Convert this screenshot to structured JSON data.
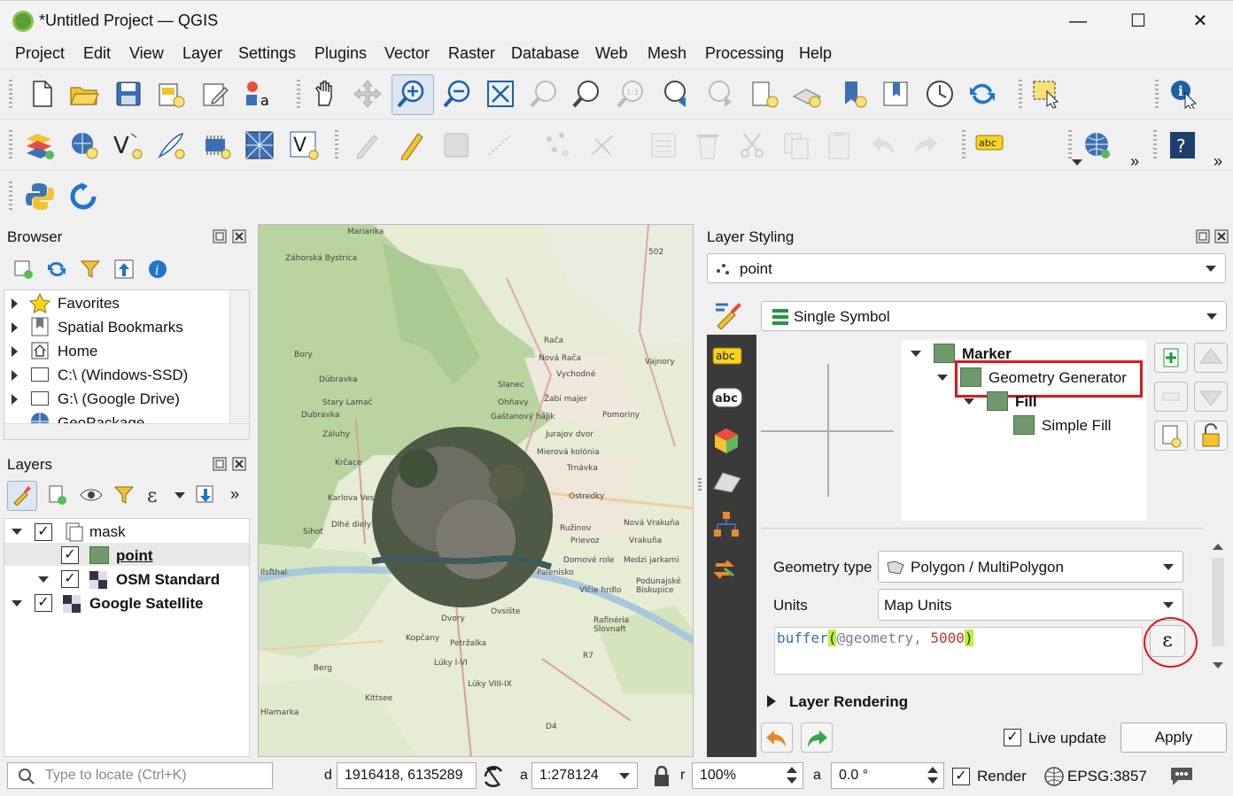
{
  "window": {
    "title": "*Untitled Project — QGIS",
    "minimize": "—",
    "maximize": "☐",
    "close": "✕"
  },
  "menu": [
    "Project",
    "Edit",
    "View",
    "Layer",
    "Settings",
    "Plugins",
    "Vector",
    "Raster",
    "Database",
    "Web",
    "Mesh",
    "Processing",
    "Help"
  ],
  "toolbar": {
    "overflow": "»"
  },
  "browser": {
    "title": "Browser",
    "items": [
      "Favorites",
      "Spatial Bookmarks",
      "Home",
      "C:\\ (Windows-SSD)",
      "G:\\ (Google Drive)",
      "GeoPackage"
    ]
  },
  "layers": {
    "title": "Layers",
    "items": [
      {
        "name": "mask",
        "checked": true,
        "bold": false
      },
      {
        "name": "point",
        "checked": true,
        "bold": true
      },
      {
        "name": "OSM Standard",
        "checked": true,
        "bold": true
      },
      {
        "name": "Google Satellite",
        "checked": true,
        "bold": true
      }
    ]
  },
  "map": {
    "labels": [
      "Marianka",
      "Záhorská Bystrica",
      "Bory",
      "Dúbravka",
      "Stary Lamač",
      "Dubravka",
      "Záluhy",
      "Krčace",
      "Karlova Ves",
      "Dlhé diely",
      "Sihoť",
      "Ilsfthal",
      "Berg",
      "Kittsee",
      "Hlamarka",
      "Rača",
      "Nová Rača",
      "Vajnory",
      "Vychodné",
      "Slanec",
      "Ohňavy",
      "Žabí majer",
      "Gaštanový hájik",
      "Pomoriny",
      "Jurajov dvor",
      "Mierová kolónia",
      "Trnávka",
      "Ostredky",
      "Ružinov",
      "Prievoz",
      "Nová Vrakuňa",
      "Vrakuňa",
      "Domové role",
      "Medzi jarkami",
      "Palenisko",
      "Podunajské Biskupice",
      "Vlčie hrdlo",
      "Dvory",
      "Ovsište",
      "Kopčany",
      "Petržalka",
      "Lúky I-VI",
      "Lúky VIII-IX",
      "Rafinéria Slovnaft",
      "502",
      "D4",
      "R7"
    ]
  },
  "styling": {
    "title": "Layer Styling",
    "layer": "point",
    "renderer": "Single Symbol",
    "tree": [
      "Marker",
      "Geometry Generator",
      "Fill",
      "Simple Fill"
    ],
    "geometry_type_label": "Geometry type",
    "geometry_type": "Polygon / MultiPolygon",
    "units_label": "Units",
    "units": "Map Units",
    "expression": {
      "func": "buffer",
      "open": "(",
      "arg": "@geometry, ",
      "num": "5000",
      "close": ")"
    },
    "epsilon": "ε",
    "layer_rendering": "Layer Rendering",
    "live_update": "Live update",
    "apply": "Apply"
  },
  "statusbar": {
    "locate_placeholder": "Type to locate (Ctrl+K)",
    "coord_label": "d",
    "coordinate": "1916418, 6135289",
    "scale_label": "a",
    "scale": "1:278124",
    "mag_label": "r",
    "magnifier": "100%",
    "rot_label": "a",
    "rotation": "0.0 °",
    "render": "Render",
    "crs": "EPSG:3857"
  },
  "colors": {
    "accent": "#1f76c9",
    "highlight_red": "#e0161b",
    "swatch": "#6f9a6b"
  }
}
